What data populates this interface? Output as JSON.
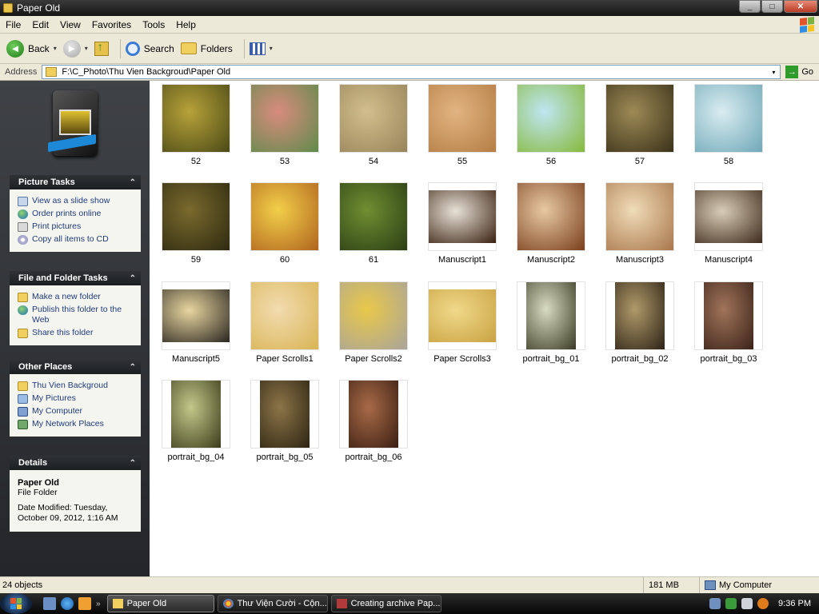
{
  "window": {
    "title": "Paper Old",
    "min": "_",
    "max": "□",
    "close": "✕"
  },
  "menu": [
    "File",
    "Edit",
    "View",
    "Favorites",
    "Tools",
    "Help"
  ],
  "toolbar": {
    "back": "Back",
    "search": "Search",
    "folders": "Folders",
    "dropdown": "▾",
    "back_arrow": "◄",
    "fwd_arrow": "►"
  },
  "address": {
    "label": "Address",
    "path": "F:\\C_Photo\\Thu Vien Backgroud\\Paper Old",
    "go": "Go",
    "go_arrow": "→"
  },
  "panels": {
    "picture_tasks": {
      "title": "Picture Tasks",
      "items": [
        "View as a slide show",
        "Order prints online",
        "Print pictures",
        "Copy all items to CD"
      ]
    },
    "file_folder_tasks": {
      "title": "File and Folder Tasks",
      "items": [
        "Make a new folder",
        "Publish this folder to the Web",
        "Share this folder"
      ]
    },
    "other_places": {
      "title": "Other Places",
      "items": [
        "Thu Vien Backgroud",
        "My Pictures",
        "My Computer",
        "My Network Places"
      ]
    },
    "details": {
      "title": "Details",
      "name": "Paper Old",
      "type": "File Folder",
      "modified": "Date Modified: Tuesday, October 09, 2012, 1:16 AM"
    },
    "chevron": "⌃"
  },
  "files": [
    {
      "name": "52",
      "shape": "sq",
      "c1": "#b7a23a",
      "c2": "#4b4a16"
    },
    {
      "name": "53",
      "shape": "sq",
      "c1": "#d98b7e",
      "c2": "#5f8b4a"
    },
    {
      "name": "54",
      "shape": "sq",
      "c1": "#d2bf8c",
      "c2": "#98845a"
    },
    {
      "name": "55",
      "shape": "sq",
      "c1": "#e2b481",
      "c2": "#b47d45"
    },
    {
      "name": "56",
      "shape": "sq",
      "c1": "#bfe6f3",
      "c2": "#86b93a"
    },
    {
      "name": "57",
      "shape": "sq",
      "c1": "#9d8a56",
      "c2": "#3a3119"
    },
    {
      "name": "58",
      "shape": "sq",
      "c1": "#d9ecf0",
      "c2": "#6fa8b8"
    },
    {
      "name": "59",
      "shape": "sq",
      "c1": "#7a6a2e",
      "c2": "#2e2a10"
    },
    {
      "name": "60",
      "shape": "sq",
      "c1": "#f2cf4a",
      "c2": "#b0641e"
    },
    {
      "name": "61",
      "shape": "sq",
      "c1": "#6f8f32",
      "c2": "#2b3d14"
    },
    {
      "name": "Manuscript1",
      "shape": "wide",
      "c1": "#e7e2d6",
      "c2": "#3a2010"
    },
    {
      "name": "Manuscript2",
      "shape": "sq",
      "c1": "#e7c9a2",
      "c2": "#7a3e1c"
    },
    {
      "name": "Manuscript3",
      "shape": "sq",
      "c1": "#f0dcb8",
      "c2": "#a8764a"
    },
    {
      "name": "Manuscript4",
      "shape": "wide",
      "c1": "#d9cdb6",
      "c2": "#3e2a1c"
    },
    {
      "name": "Manuscript5",
      "shape": "wide",
      "c1": "#e8d6a0",
      "c2": "#2a2620"
    },
    {
      "name": "Paper Scrolls1",
      "shape": "sq",
      "c1": "#f2dcb0",
      "c2": "#d8b454"
    },
    {
      "name": "Paper Scrolls2",
      "shape": "sq",
      "c1": "#e9c84a",
      "c2": "#a9a49a"
    },
    {
      "name": "Paper Scrolls3",
      "shape": "wide",
      "c1": "#f0d98a",
      "c2": "#c9a242"
    },
    {
      "name": "portrait_bg_01",
      "shape": "tall",
      "c1": "#d8dcc0",
      "c2": "#3a3a24"
    },
    {
      "name": "portrait_bg_02",
      "shape": "tall",
      "c1": "#b09a6a",
      "c2": "#2c2216"
    },
    {
      "name": "portrait_bg_03",
      "shape": "tall",
      "c1": "#a0745a",
      "c2": "#3a2218"
    },
    {
      "name": "portrait_bg_04",
      "shape": "tall",
      "c1": "#c4c88a",
      "c2": "#3a3c1a"
    },
    {
      "name": "portrait_bg_05",
      "shape": "tall",
      "c1": "#8c7448",
      "c2": "#2c2412"
    },
    {
      "name": "portrait_bg_06",
      "shape": "tall",
      "c1": "#a86a48",
      "c2": "#3a1e12"
    }
  ],
  "status": {
    "count": "24 objects",
    "size": "181 MB",
    "zone": "My Computer"
  },
  "taskbar": {
    "more": "»",
    "buttons": [
      "Paper Old",
      "Thư Viện Cười - Cộn...",
      "Creating archive Pap..."
    ],
    "clock": "9:36 PM"
  }
}
